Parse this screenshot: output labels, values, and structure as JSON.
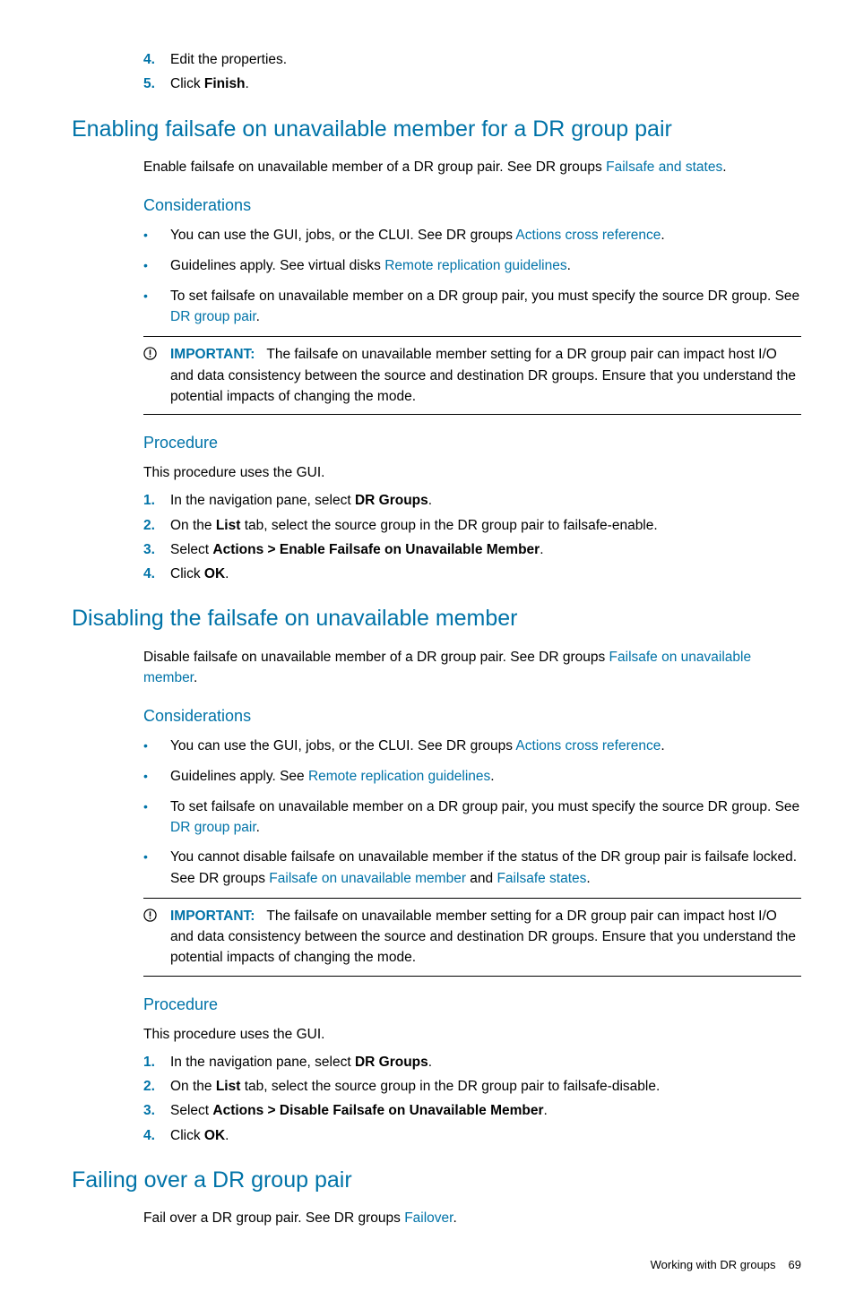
{
  "top_list": [
    {
      "num": "4.",
      "pre": "Edit the properties.",
      "bold": "",
      "post": ""
    },
    {
      "num": "5.",
      "pre": "Click ",
      "bold": "Finish",
      "post": "."
    }
  ],
  "sec1": {
    "heading": "Enabling failsafe on unavailable member for a DR group pair",
    "intro_pre": "Enable failsafe on unavailable member of a DR group pair. See DR groups ",
    "intro_link": "Failsafe and states",
    "intro_post": ".",
    "considerations_h": "Considerations",
    "bullets": [
      {
        "pre": "You can use the GUI, jobs, or the CLUI. See DR groups ",
        "link": "Actions cross reference",
        "mid": "",
        "link2": "",
        "post": "."
      },
      {
        "pre": "Guidelines apply. See virtual disks ",
        "link": "Remote replication guidelines",
        "mid": "",
        "link2": "",
        "post": "."
      },
      {
        "pre": "To set failsafe on unavailable member on a DR group pair, you must specify the source DR group. See ",
        "link": "DR group pair",
        "mid": "",
        "link2": "",
        "post": "."
      }
    ],
    "important_label": "IMPORTANT:",
    "important_text": "The failsafe on unavailable member setting for a DR group pair can impact host I/O and data consistency between the source and destination DR groups. Ensure that you understand the potential impacts of changing the mode.",
    "procedure_h": "Procedure",
    "procedure_intro": "This procedure uses the GUI.",
    "steps": [
      {
        "num": "1.",
        "pre": "In the navigation pane, select ",
        "bold": "DR Groups",
        "post": "."
      },
      {
        "num": "2.",
        "pre": "On the ",
        "bold": "List",
        "post": " tab, select the source group in the DR group pair to failsafe-enable."
      },
      {
        "num": "3.",
        "pre": "Select ",
        "bold": "Actions > Enable Failsafe on Unavailable Member",
        "post": "."
      },
      {
        "num": "4.",
        "pre": "Click ",
        "bold": "OK",
        "post": "."
      }
    ]
  },
  "sec2": {
    "heading": "Disabling the failsafe on unavailable member",
    "intro_pre": "Disable failsafe on unavailable member of a DR group pair. See DR groups ",
    "intro_link": "Failsafe on unavailable member",
    "intro_post": ".",
    "considerations_h": "Considerations",
    "bullets": [
      {
        "pre": "You can use the GUI, jobs, or the CLUI. See DR groups ",
        "link": "Actions cross reference",
        "mid": "",
        "link2": "",
        "post": "."
      },
      {
        "pre": "Guidelines apply. See ",
        "link": "Remote replication guidelines",
        "mid": "",
        "link2": "",
        "post": "."
      },
      {
        "pre": "To set failsafe on unavailable member on a DR group pair, you must specify the source DR group. See ",
        "link": "DR group pair",
        "mid": "",
        "link2": "",
        "post": "."
      },
      {
        "pre": "You cannot disable failsafe on unavailable member if the status of the DR group pair is failsafe locked. See DR groups ",
        "link": "Failsafe on unavailable member",
        "mid": " and ",
        "link2": "Failsafe states",
        "post": "."
      }
    ],
    "important_label": "IMPORTANT:",
    "important_text": "The failsafe on unavailable member setting for a DR group pair can impact host I/O and data consistency between the source and destination DR groups. Ensure that you understand the potential impacts of changing the mode.",
    "procedure_h": "Procedure",
    "procedure_intro": "This procedure uses the GUI.",
    "steps": [
      {
        "num": "1.",
        "pre": "In the navigation pane, select ",
        "bold": "DR Groups",
        "post": "."
      },
      {
        "num": "2.",
        "pre": "On the ",
        "bold": "List",
        "post": " tab, select the source group in the DR group pair to failsafe-disable."
      },
      {
        "num": "3.",
        "pre": "Select ",
        "bold": "Actions > Disable Failsafe on Unavailable Member",
        "post": "."
      },
      {
        "num": "4.",
        "pre": "Click ",
        "bold": "OK",
        "post": "."
      }
    ]
  },
  "sec3": {
    "heading": "Failing over a DR group pair",
    "intro_pre": "Fail over a DR group pair. See DR groups ",
    "intro_link": "Failover",
    "intro_post": "."
  },
  "footer": {
    "text": "Working with DR groups",
    "page": "69"
  }
}
